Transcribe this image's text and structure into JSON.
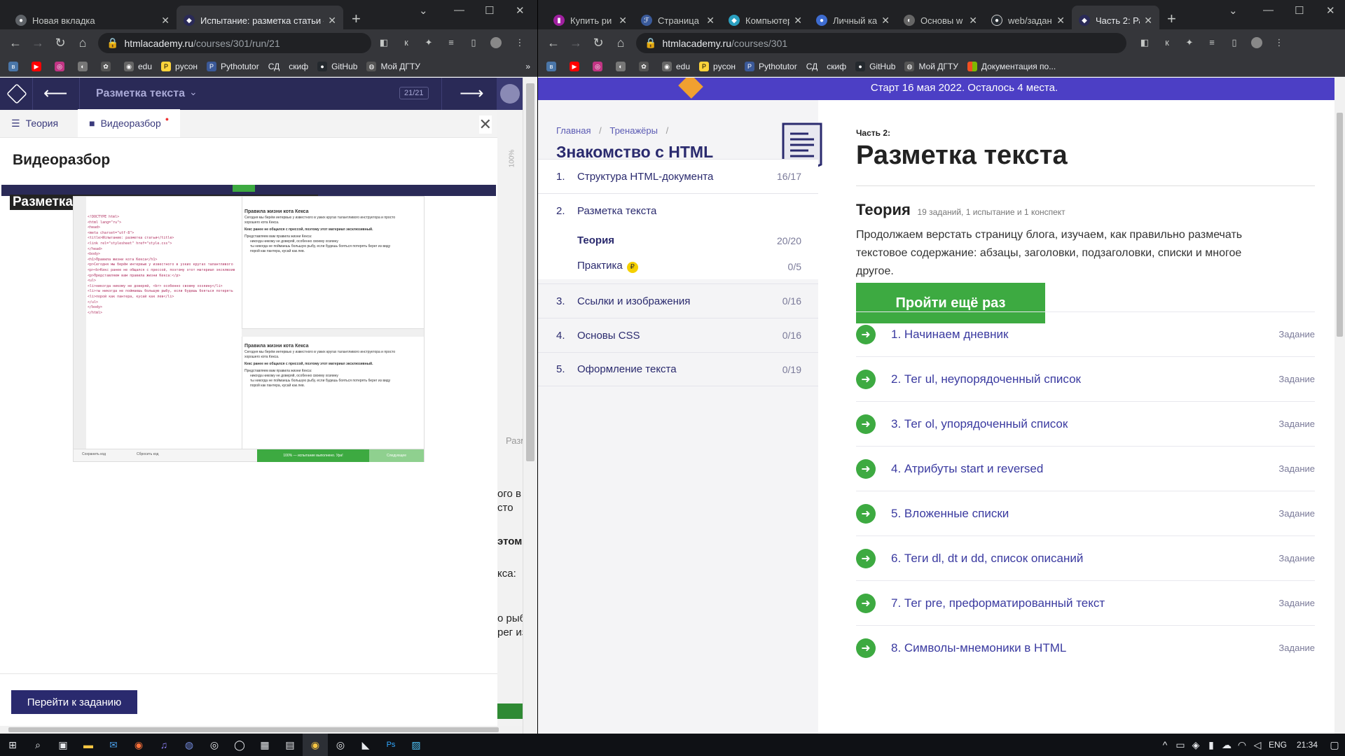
{
  "left_window": {
    "tabs": [
      {
        "title": "Новая вкладка",
        "active": false
      },
      {
        "title": "Испытание: разметка статьи —",
        "active": true
      }
    ],
    "url_host": "htmlacademy.ru",
    "url_path": "/courses/301/run/21",
    "bookmarks": [
      "edu",
      "pycон",
      "Pythotutor",
      "СД",
      "скиф",
      "GitHub",
      "Мой ДГТУ"
    ],
    "academy_header": {
      "back": "⟵",
      "section": "Разметка текста",
      "progress": "21/21",
      "forward": "⟶"
    },
    "panel_tabs": [
      "Теория",
      "Видеоразбор"
    ],
    "panel_title": "Видеоразбор",
    "video_caption": "Разметка текста. Испытание: разметка статьи",
    "video_screen": {
      "code_lines": [
        "<!DOCTYPE html>",
        "<html lang=\"ru\">",
        "<head>",
        "<meta charset=\"utf-8\">",
        "<title>Испытание: разметка статьи</title>",
        "<link rel=\"stylesheet\" href=\"style.css\">",
        "</head>",
        "<body>",
        "<h1>Правила жизни кота Кекса</h1>",
        "<p>Сегодня мы берём интервью у известного в узких кругах талантливого инструктора и просто хорошего кота Кекса.</p>",
        "<p><b>Кекс ранее не общался с прессой, поэтому этот материал эксклюзивный.</b></p>",
        "<p>Представляем вам правила жизни Кекса:</p>",
        "<ul>",
        "<li>никогда никому не доверяй, <br> особенно своему хозяину</li>",
        "<li>ты никогда не поймаешь большую рыбу, если будешь бояться потерять берег из виду</li>",
        "<li>порой как пантера, кусай как лев</li>",
        "</ul>",
        "</body>",
        "</html>"
      ],
      "result_title": "Правила жизни кота Кекса",
      "result_paragraph": "Сегодня мы берём интервью у известного в узких кругах талантливого инструктора и просто хорошего кота Кекса.",
      "result_bold": "Кекс ранее не общался с прессой, поэтому этот материал эксклюзивный.",
      "result_list_intro": "Представляем вам правила жизни Кекса:",
      "result_items": [
        "никогда никому не доверяй, особенно своему хозяину",
        "ты никогда не поймаешь большую рыбу, если будешь бояться потерять берег из виду",
        "порой как пантера, кусай как лев."
      ],
      "bottom_save": "Сохранить код",
      "bottom_reset": "Сбросить код",
      "bottom_status": "100% — испытание выполнено. Ура!",
      "bottom_next": "Следующее"
    },
    "go_button": "Перейти к заданию",
    "peek_texts": [
      "ого в у",
      "сто",
      "этом",
      "кса:",
      "о рыбу",
      "рег из",
      "Разм"
    ]
  },
  "right_window": {
    "tabs": [
      {
        "title": "Купить ри",
        "active": false
      },
      {
        "title": "Страница",
        "active": false
      },
      {
        "title": "Компьютер",
        "active": false
      },
      {
        "title": "Личный ка",
        "active": false
      },
      {
        "title": "Основы w",
        "active": false
      },
      {
        "title": "web/задан",
        "active": false
      },
      {
        "title": "Часть 2: Ра",
        "active": true
      }
    ],
    "url_host": "htmlacademy.ru",
    "url_path": "/courses/301",
    "bookmarks": [
      "edu",
      "pycон",
      "Pythotutor",
      "СД",
      "скиф",
      "GitHub",
      "Мой ДГТУ",
      "Документация по..."
    ],
    "banner": "Старт 16 мая 2022. Осталось 4 места.",
    "breadcrumb": [
      "Главная",
      "/",
      "Тренажёры",
      "/"
    ],
    "course_title": "Знакомство с HTML и CSS",
    "modules": [
      {
        "num": "1.",
        "title": "Структура HTML-документа",
        "count": "16/17"
      },
      {
        "num": "2.",
        "title": "Разметка текста",
        "count": ""
      },
      {
        "num": "",
        "title": "Теория",
        "count": "20/20"
      },
      {
        "num": "",
        "title": "Практика",
        "count": "0/5"
      },
      {
        "num": "3.",
        "title": "Ссылки и изображения",
        "count": "0/16"
      },
      {
        "num": "4.",
        "title": "Основы CSS",
        "count": "0/16"
      },
      {
        "num": "5.",
        "title": "Оформление текста",
        "count": "0/19"
      }
    ],
    "part_label": "Часть 2:",
    "part_title": "Разметка текста",
    "theory_heading": "Теория",
    "theory_meta": "19 заданий, 1 испытание и 1 конспект",
    "theory_desc": "Продолжаем верстать страницу блога, изучаем, как правильно размечать текстовое содержание: абзацы, заголовки, подзаголовки, списки и многое другое.",
    "retry_button": "Пройти ещё раз",
    "tasks": [
      {
        "title": "1. Начинаем дневник",
        "kind": "Задание"
      },
      {
        "title": "2. Тег ul, неупорядоченный список",
        "kind": "Задание"
      },
      {
        "title": "3. Тег ol, упорядоченный список",
        "kind": "Задание"
      },
      {
        "title": "4. Атрибуты start и reversed",
        "kind": "Задание"
      },
      {
        "title": "5. Вложенные списки",
        "kind": "Задание"
      },
      {
        "title": "6. Теги dl, dt и dd, список описаний",
        "kind": "Задание"
      },
      {
        "title": "7. Тег pre, преформатированный текст",
        "kind": "Задание"
      },
      {
        "title": "8. Символы-мнемоники в HTML",
        "kind": "Задание"
      }
    ]
  },
  "taskbar": {
    "lang": "ENG",
    "time": "21:34"
  },
  "colors": {
    "academy_dark": "#2a2a57",
    "academy_blue": "#2a2a6e",
    "green": "#3daa41",
    "banner": "#4c3fc5"
  }
}
